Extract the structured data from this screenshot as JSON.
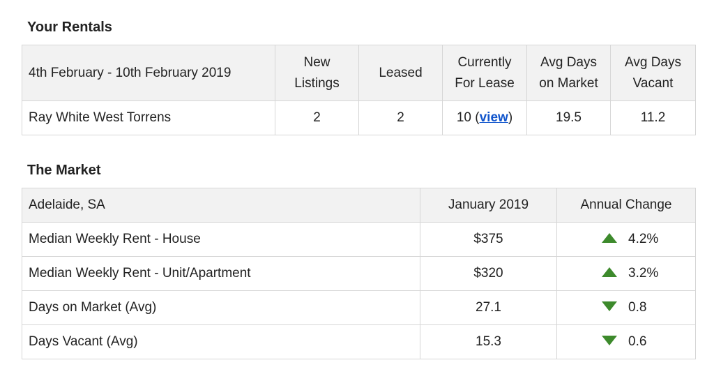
{
  "rentals": {
    "title": "Your Rentals",
    "date_range": "4th February - 10th February 2019",
    "headers": {
      "new_listings_1": "New",
      "new_listings_2": "Listings",
      "leased": "Leased",
      "for_lease_1": "Currently",
      "for_lease_2": "For Lease",
      "avg_market_1": "Avg Days",
      "avg_market_2": "on Market",
      "avg_vacant_1": "Avg Days",
      "avg_vacant_2": "Vacant"
    },
    "row": {
      "office": "Ray White West Torrens",
      "new_listings": "2",
      "leased": "2",
      "for_lease_count": "10",
      "view_open": "(",
      "view_label": "view",
      "view_close": ")",
      "avg_days_market": "19.5",
      "avg_days_vacant": "11.2"
    }
  },
  "market": {
    "title": "The Market",
    "location": "Adelaide, SA",
    "period_header": "January 2019",
    "change_header": "Annual Change",
    "rows": [
      {
        "label": "Median Weekly Rent - House",
        "value": "$375",
        "direction": "up",
        "change": "4.2%"
      },
      {
        "label": "Median Weekly Rent - Unit/Apartment",
        "value": "$320",
        "direction": "up",
        "change": "3.2%"
      },
      {
        "label": "Days on Market (Avg)",
        "value": "27.1",
        "direction": "down",
        "change": "0.8"
      },
      {
        "label": "Days Vacant (Avg)",
        "value": "15.3",
        "direction": "down",
        "change": "0.6"
      }
    ],
    "colors": {
      "trend": "#3d8a2c"
    }
  }
}
